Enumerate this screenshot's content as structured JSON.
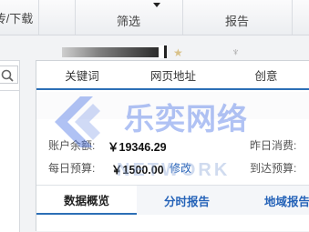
{
  "toolbar": {
    "upload_download": "传/下载",
    "filter": "筛选",
    "report": "报告"
  },
  "card_tabs": [
    "关键词",
    "网页地址",
    "创意"
  ],
  "account": {
    "balance_label": "账户余额:",
    "balance_value": "￥19346.29",
    "daily_budget_label": "每日预算:",
    "daily_budget_value": "￥1500.00",
    "modify_label": "修改",
    "yesterday_spend_label": "昨日消费:",
    "reach_budget_label": "到达预算:"
  },
  "report_tabs": [
    "数据概览",
    "分时报告",
    "地域报告"
  ],
  "watermark": {
    "cn": "乐奕网络",
    "en": "NETWORK"
  },
  "colors": {
    "accent": "#2d6fb6",
    "link": "#2563b8",
    "watermark": "#4f78e6"
  }
}
